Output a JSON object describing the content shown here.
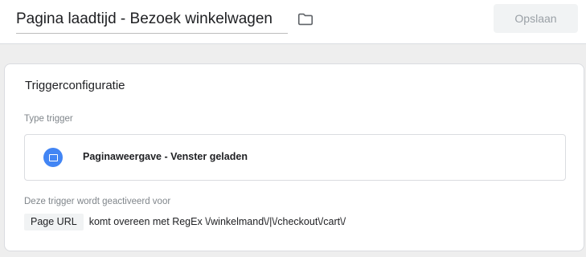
{
  "header": {
    "title": "Pagina laadtijd - Bezoek winkelwagen",
    "save_label": "Opslaan"
  },
  "trigger_config": {
    "heading": "Triggerconfiguratie",
    "type_label": "Type trigger",
    "type_value": "Paginaweergave - Venster geladen",
    "fires_on_label": "Deze trigger wordt geactiveerd voor",
    "condition": {
      "variable": "Page URL",
      "rest": "komt overeen met RegEx \\/winkelmand\\/|\\/checkout\\/cart\\/"
    }
  },
  "colors": {
    "accent_blue": "#4285f4",
    "background": "#eeeeee"
  },
  "icons": [
    "folder-icon",
    "pageview-icon"
  ]
}
